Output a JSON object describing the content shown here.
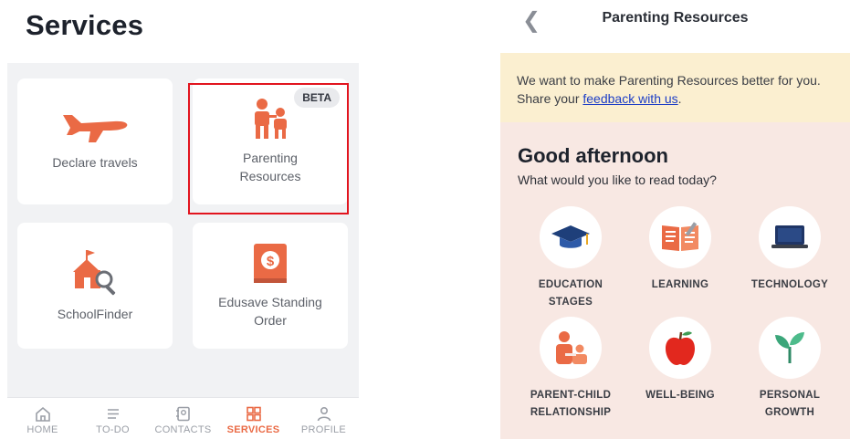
{
  "services": {
    "title": "Services",
    "tiles": [
      {
        "label": "Declare travels"
      },
      {
        "label": "Parenting\nResources",
        "badge": "BETA"
      },
      {
        "label": "SchoolFinder"
      },
      {
        "label": "Edusave Standing\nOrder"
      }
    ],
    "tabs": [
      {
        "label": "HOME",
        "icon": "home-icon"
      },
      {
        "label": "TO-DO",
        "icon": "list-icon"
      },
      {
        "label": "CONTACTS",
        "icon": "contacts-icon"
      },
      {
        "label": "SERVICES",
        "icon": "grid-icon",
        "active": true
      },
      {
        "label": "PROFILE",
        "icon": "person-icon"
      }
    ],
    "accent": "#ea6a45",
    "highlight_color": "#e2141e"
  },
  "resources": {
    "title": "Parenting Resources",
    "banner": {
      "text_before": "We want to make Parenting Resources better for you. Share your ",
      "link": "feedback with us",
      "text_after": "."
    },
    "greeting": "Good afternoon",
    "prompt": "What would you like to read today?",
    "categories": [
      {
        "label": "EDUCATION\nSTAGES",
        "icon": "graduation-cap-icon"
      },
      {
        "label": "LEARNING",
        "icon": "book-icon"
      },
      {
        "label": "TECHNOLOGY",
        "icon": "laptop-icon"
      },
      {
        "label": "PARENT-CHILD\nRELATIONSHIP",
        "icon": "parent-child-icon"
      },
      {
        "label": "WELL-BEING",
        "icon": "apple-icon"
      },
      {
        "label": "PERSONAL\nGROWTH",
        "icon": "sprout-icon"
      }
    ],
    "colors": {
      "banner": "#fbefd0",
      "background": "#f8e8e3",
      "link": "#1d3ec6"
    }
  }
}
